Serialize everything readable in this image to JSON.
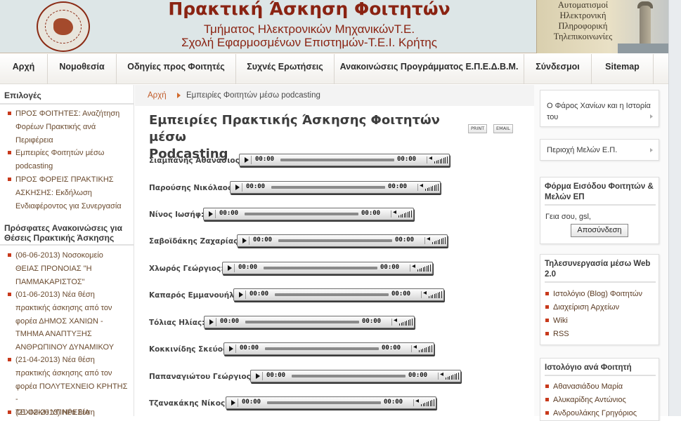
{
  "header": {
    "title": "Πρακτική Άσκηση Φοιτητών",
    "subtitle1": "Τμήματος Ηλεκτρονικών ΜηχανικώνΤ.Ε.",
    "subtitle2": "Σχολή Εφαρμοσμένων Επιστημών-Τ.Ε.Ι. Κρήτης",
    "banner_lines": [
      "Αυτοματισμοί",
      "Ηλεκτρονική",
      "Πληροφορική",
      "Τηλεπικοινωνίες"
    ]
  },
  "nav": {
    "items": [
      "Αρχή",
      "Νομοθεσία",
      "Οδηγίες προς Φοιτητές",
      "Συχνές Ερωτήσεις",
      "Ανακοινώσεις Προγράμματος Ε.Π.Ε.Δ.Β.Μ.",
      "Σύνδεσμοι",
      "Sitemap"
    ]
  },
  "left": {
    "options_title": "Επιλογές",
    "options": [
      [
        "ΠΡΟΣ ΦΟΙΤΗΤΕΣ: Αναζήτηση",
        "Φορέων Πρακτικής ανά",
        "Περιφέρεια"
      ],
      [
        "Εμπειρίες Φοιτητών μέσω",
        "podcasting"
      ],
      [
        "ΠΡΟΣ ΦΟΡΕΙΣ ΠΡΑΚΤΙΚΗΣ",
        "ΑΣΚΗΣΗΣ: Εκδήλωση",
        "Ενδιαφέροντος για Συνεργασία"
      ]
    ],
    "news_title": [
      "Πρόσφατες Ανακοινώσεις για",
      "Θέσεις Πρακτικής Άσκησης"
    ],
    "news": [
      [
        "(06-06-2013)  Νοσοκομείο",
        "ΘΕΙΑΣ ΠΡΟΝΟΙΑΣ \"Η",
        "ΠΑΜΜΑΚΑΡΙΣΤΟΣ\""
      ],
      [
        "(01-06-2013)  Νέα θέση",
        "πρακτικής άσκησης από τον",
        "φορέα ΔΗΜΟΣ ΧΑΝΙΩΝ -",
        "ΤΜΗΜΑ ΑΝΑΠΤΥΞΗΣ",
        "ΑΝΘΡΩΠΙΝΟΥ ΔΥΝΑΜΙΚΟΥ"
      ],
      [
        "(21-04-2013)  Νέα θέση",
        "πρακτικής άσκησης από τον",
        "φορέα ΠΟΛΥΤΕΧΝΕΙΟ ΚΡΗΤΗΣ -",
        "ΤΕΧΝΙΚΗ ΥΠΗΡΕΣΙΑ"
      ],
      [
        "(21-02-2013)  Νέα θέση"
      ]
    ]
  },
  "content": {
    "breadcrumb_home": "Αρχή",
    "breadcrumb_current": "Εμπειρίες Φοιτητών μέσω podcasting",
    "title_line1": "Εμπειρίες Πρακτικής Άσκησης Φοιτητών μέσω",
    "title_line2": "Podcasting",
    "print_label": "PRINT",
    "email_label": "EMAIL",
    "players": [
      {
        "name": "Σιαμπάνης Αθανάσιος:",
        "start": "00:00",
        "end": "00:00"
      },
      {
        "name": "Παρούσης Νικόλαος:",
        "start": "00:00",
        "end": "00:00"
      },
      {
        "name": "Νίνος Ιωσήφ:",
        "start": "00:00",
        "end": "00:00"
      },
      {
        "name": "Σαβοϊδάκης Ζαχαρίας:",
        "start": "00:00",
        "end": "00:00"
      },
      {
        "name": "Χλωρός Γεώργιος:",
        "start": "00:00",
        "end": "00:00"
      },
      {
        "name": "Καπαρός Εμμανουήλ:",
        "start": "00:00",
        "end": "00:00"
      },
      {
        "name": "Τόλιας Ηλίας:",
        "start": "00:00",
        "end": "00:00"
      },
      {
        "name": "Κοκκινίδης Σκεύος:",
        "start": "00:00",
        "end": "00:00"
      },
      {
        "name": "Παπαναγιώτου Γεώργιος:",
        "start": "00:00",
        "end": "00:00"
      },
      {
        "name": "Τζανακάκης Νίκος:",
        "start": "00:00",
        "end": "00:00"
      }
    ]
  },
  "right": {
    "box1": [
      "Ο Φάρος Χανίων και η Ιστορία",
      "του"
    ],
    "box2": "Περιοχή Μελών Ε.Π.",
    "login_title": [
      "Φόρμα Εισόδου Φοιτητών &",
      "Μελών ΕΠ"
    ],
    "greeting": "Γεια σου, gsl,",
    "logout_label": "Αποσύνδεση",
    "web_title": [
      "Τηλεσυνεργασία μέσω Web",
      "2.0"
    ],
    "web_items": [
      "Ιστολόγιο (Blog) Φοιτητών",
      "Διαχείριση Αρχείων",
      "Wiki",
      "RSS"
    ],
    "blog_title": "Ιστολόγιο ανά Φοιτητή",
    "blog_items": [
      "Αθανασιάδου Μαρία",
      "Αλυκαρίδης Αντώνιος",
      "Ανδρουλάκης Γρηγόριος"
    ]
  },
  "colors": {
    "header_title": "#8a2312",
    "bullet": "#c8391b",
    "breadcrumb_link": "#c05a28"
  }
}
